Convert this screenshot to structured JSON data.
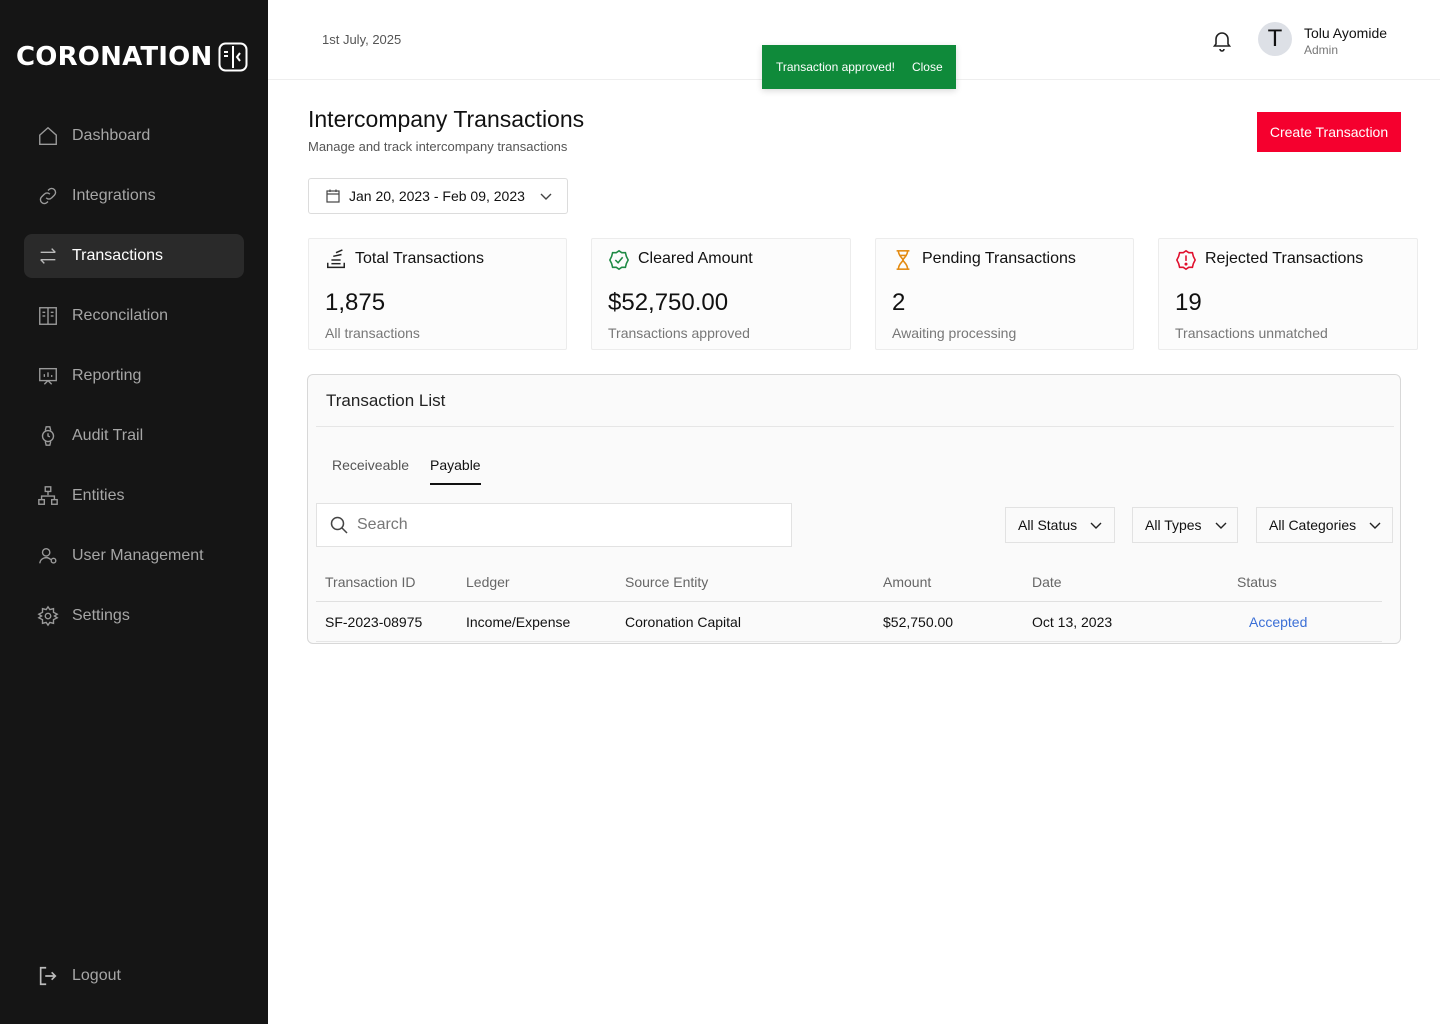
{
  "app": {
    "brand": "CORONATION"
  },
  "sidebar": {
    "items": [
      {
        "label": "Dashboard",
        "icon": "home-icon"
      },
      {
        "label": "Integrations",
        "icon": "link-icon"
      },
      {
        "label": "Transactions",
        "icon": "arrows-icon",
        "active": true
      },
      {
        "label": "Reconcilation",
        "icon": "ledger-icon"
      },
      {
        "label": "Reporting",
        "icon": "presentation-chart-icon"
      },
      {
        "label": "Audit Trail",
        "icon": "watch-icon"
      },
      {
        "label": "Entities",
        "icon": "hierarchy-icon"
      },
      {
        "label": "User Management",
        "icon": "user-gear-icon"
      },
      {
        "label": "Settings",
        "icon": "gear-icon"
      }
    ],
    "logout_label": "Logout"
  },
  "header": {
    "date": "1st July, 2025",
    "user": {
      "initial": "T",
      "name": "Tolu Ayomide",
      "role": "Admin"
    }
  },
  "toast": {
    "message": "Transaction approved!",
    "close_label": "Close",
    "color": "#0f8a3a"
  },
  "page": {
    "title": "Intercompany Transactions",
    "subtitle": "Manage and track intercompany transactions",
    "create_button": "Create Transaction",
    "date_range": "Jan 20, 2023 - Feb 09, 2023"
  },
  "stats": [
    {
      "title": "Total Transactions",
      "value": "1,875",
      "sub": "All transactions",
      "icon": "stack-icon"
    },
    {
      "title": "Cleared Amount",
      "value": "$52,750.00",
      "sub": "Transactions approved",
      "icon": "verified-badge-icon"
    },
    {
      "title": "Pending Transactions",
      "value": "2",
      "sub": "Awaiting processing",
      "icon": "hourglass-icon"
    },
    {
      "title": "Rejected Transactions",
      "value": "19",
      "sub": "Transactions unmatched",
      "icon": "alert-octagon-icon"
    }
  ],
  "transaction_list": {
    "title": "Transaction List",
    "tabs": [
      {
        "label": "Receiveable",
        "active": false
      },
      {
        "label": "Payable",
        "active": true
      }
    ],
    "search_placeholder": "Search",
    "filters": [
      "All Status",
      "All Types",
      "All Categories"
    ],
    "columns": [
      "Transaction ID",
      "Ledger",
      "Source Entity",
      "Amount",
      "Date",
      "Status"
    ],
    "rows": [
      {
        "id": "SF-2023-08975",
        "ledger": "Income/Expense",
        "source": "Coronation Capital",
        "amount": "$52,750.00",
        "date": "Oct 13, 2023",
        "status": "Accepted"
      }
    ]
  },
  "colors": {
    "accent_red": "#f5002e",
    "success_green": "#0f8a3a",
    "status_link": "#3b6fd6",
    "sidebar_bg": "#151515"
  }
}
